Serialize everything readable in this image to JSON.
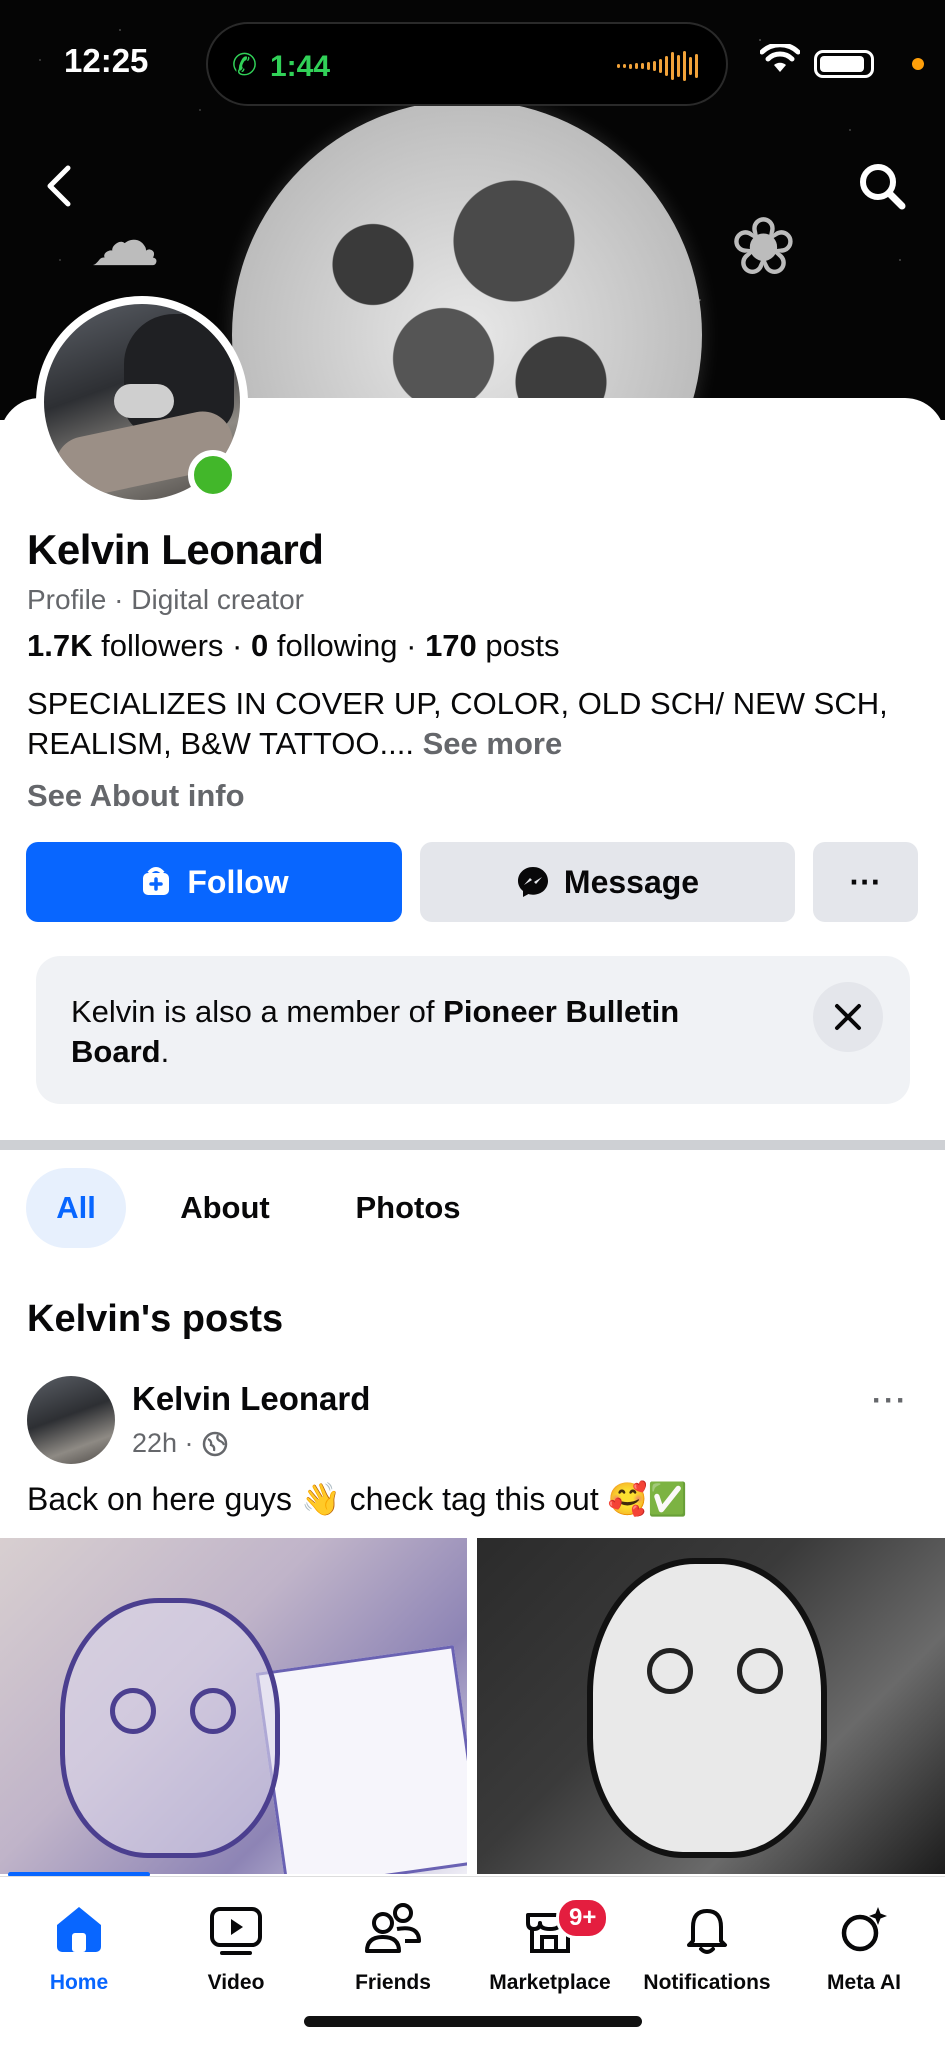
{
  "status_bar": {
    "time": "12:25",
    "call_time": "1:44"
  },
  "profile": {
    "name": "Kelvin Leonard",
    "subtitle": "Profile · Digital creator",
    "stats": {
      "followers_count": "1.7K",
      "followers_label": "followers",
      "following_count": "0",
      "following_label": "following",
      "posts_count": "170",
      "posts_label": "posts",
      "separator": " · "
    },
    "bio": "SPECIALIZES IN COVER UP, COLOR, OLD SCH/ NEW SCH, REALISM, B&W TATTOO.... ",
    "see_more": "See more",
    "see_about": "See About info"
  },
  "actions": {
    "follow": "Follow",
    "message": "Message",
    "more": "···"
  },
  "notice": {
    "prefix": "Kelvin is also a member of ",
    "group": "Pioneer Bulletin Board",
    "suffix": "."
  },
  "tabs": [
    {
      "label": "All"
    },
    {
      "label": "About"
    },
    {
      "label": "Photos"
    }
  ],
  "posts_section": {
    "title": "Kelvin's posts"
  },
  "post": {
    "author": "Kelvin Leonard",
    "time": "22h ·",
    "text": "Back on here guys 👋 check tag this out 🥰✅",
    "more": "···"
  },
  "bottom_nav": {
    "items": [
      {
        "label": "Home"
      },
      {
        "label": "Video"
      },
      {
        "label": "Friends"
      },
      {
        "label": "Marketplace",
        "badge": "9+"
      },
      {
        "label": "Notifications"
      },
      {
        "label": "Meta AI"
      }
    ]
  },
  "colors": {
    "accent": "#0866ff",
    "badge": "#e41e3f",
    "online": "#42b72a",
    "call": "#31d158"
  }
}
